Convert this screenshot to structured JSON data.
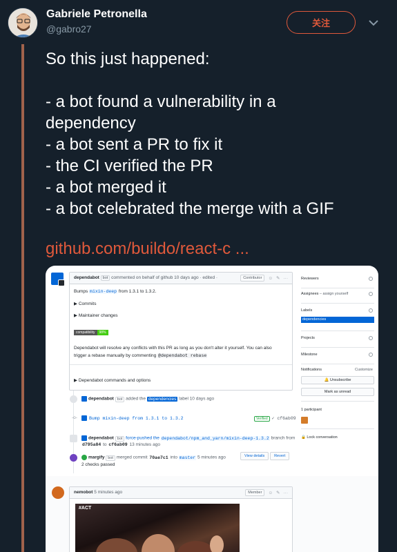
{
  "tweet": {
    "author_name": "Gabriele Petronella",
    "author_handle": "@gabro27",
    "follow_label": "关注",
    "text_lines": [
      "So this just happened:",
      "",
      "- a bot found a vulnerability in a",
      "dependency",
      "- a bot sent a PR to fix it",
      "- the CI verified the PR",
      "- a bot merged it",
      "- a bot celebrated the merge with a GIF"
    ],
    "link_text": "github.com/buildo/react-c ...",
    "colors": {
      "background": "#15202b",
      "accent": "#e0593b",
      "muted": "#8899a6"
    }
  },
  "github": {
    "comment": {
      "author": "dependabot",
      "bot_tag": "bot",
      "meta": "commented on behalf of github 10 days ago · edited ·",
      "role": "Contributor",
      "bumps_prefix": "Bumps",
      "bumps_pkg": "mixin-deep",
      "bumps_suffix": "from 1.3.1 to 1.3.2.",
      "commits": "Commits",
      "maintainer_changes": "Maintainer changes",
      "badge_left": "compatibility",
      "badge_right": "98%",
      "resolve_text_1": "Dependabot will resolve any conflicts with this PR as long as you don't alter it yourself. You can also",
      "resolve_text_2": "trigger a rebase manually by commenting",
      "rebase_cmd": "@dependabot rebase",
      "commands": "Dependabot commands and options"
    },
    "timeline": {
      "label_event_author": "dependabot",
      "label_event_bot": "bot",
      "label_event_action": "added the",
      "label_event_label": "dependencies",
      "label_event_suffix": "label 10 days ago",
      "commit_msg": "Bump mixin-deep from 1.3.1 to 1.3.2",
      "verified": "Verified",
      "commit_sha": "✓ cf6ab09",
      "push_author": "dependabot",
      "push_bot": "bot",
      "push_action": "force-pushed the",
      "push_branch": "dependabot/npm_and_yarn/mixin-deep-1.3.2",
      "push_suffix": "branch from",
      "push_from": "d795a84",
      "push_to_word": "to",
      "push_to": "cf6ab09",
      "push_time": "13 minutes ago",
      "merge_author": "margify",
      "merge_bot": "bot",
      "merge_action": "merged commit",
      "merge_sha": "70ae7c1",
      "merge_into": "into",
      "merge_branch": "master",
      "merge_time": "5 minutes ago",
      "checks": "2 checks passed",
      "view_details": "View details",
      "revert": "Revert"
    },
    "sidebar": {
      "reviewers": "Reviewers",
      "assignees": "Assignees",
      "assign_yourself": "– assign yourself",
      "labels": "Labels",
      "label_value": "dependencies",
      "projects": "Projects",
      "milestone": "Milestone",
      "notifications": "Notifications",
      "customize": "Customize",
      "unsubscribe": "🔔 Unsubscribe",
      "mark_unread": "Mark as unread",
      "participants": "1 participant",
      "lock": "🔒 Lock conversation"
    },
    "gif_comment": {
      "author": "nemobot",
      "time": "5 minutes ago",
      "role": "Member",
      "gif_tag": "#ACT"
    }
  }
}
